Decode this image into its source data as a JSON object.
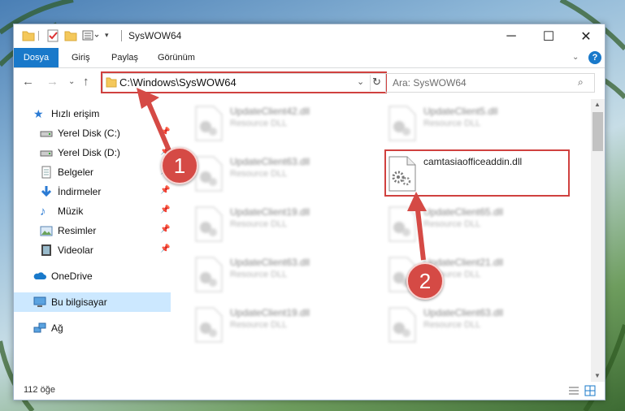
{
  "window": {
    "title": "SysWOW64",
    "controls": [
      "─",
      "☐",
      "✕"
    ]
  },
  "ribbon": {
    "tabs": [
      "Dosya",
      "Giriş",
      "Paylaş",
      "Görünüm"
    ]
  },
  "nav": {
    "address": "C:\\Windows\\SysWOW64",
    "search_placeholder": "Ara: SysWOW64"
  },
  "sidebar": {
    "items": [
      {
        "label": "Hızlı erişim",
        "icon": "star-icon"
      },
      {
        "label": "Yerel Disk (C:)",
        "icon": "drive-icon"
      },
      {
        "label": "Yerel Disk (D:)",
        "icon": "drive-icon"
      },
      {
        "label": "Belgeler",
        "icon": "documents-icon"
      },
      {
        "label": "İndirmeler",
        "icon": "download-icon"
      },
      {
        "label": "Müzik",
        "icon": "music-icon"
      },
      {
        "label": "Resimler",
        "icon": "pictures-icon"
      },
      {
        "label": "Videolar",
        "icon": "videos-icon"
      },
      {
        "label": "OneDrive",
        "icon": "cloud-icon"
      },
      {
        "label": "Bu bilgisayar",
        "icon": "computer-icon"
      },
      {
        "label": "Ağ",
        "icon": "network-icon"
      }
    ]
  },
  "files": [
    {
      "name": "UpdateClient42.dll",
      "desc": "Resource DLL"
    },
    {
      "name": "UpdateClient5.dll",
      "desc": "Resource DLL"
    },
    {
      "name": "UpdateClient63.dll",
      "desc": "Resource DLL"
    },
    {
      "name": "camtasiaofficeaddin.dll",
      "desc": ""
    },
    {
      "name": "UpdateClient19.dll",
      "desc": "Resource DLL"
    },
    {
      "name": "UpdateClient65.dll",
      "desc": "Resource DLL"
    },
    {
      "name": "UpdateClient63.dll",
      "desc": "Resource DLL"
    },
    {
      "name": "UpdateClient21.dll",
      "desc": "Resource DLL"
    },
    {
      "name": "UpdateClient19.dll",
      "desc": "Resource DLL"
    },
    {
      "name": "UpdateClient63.dll",
      "desc": "Resource DLL"
    }
  ],
  "status": {
    "count": "112 öğe"
  },
  "callouts": [
    "1",
    "2"
  ],
  "colors": {
    "accent": "#1979ca",
    "highlight": "#d0413f",
    "callout": "#d54a45"
  }
}
